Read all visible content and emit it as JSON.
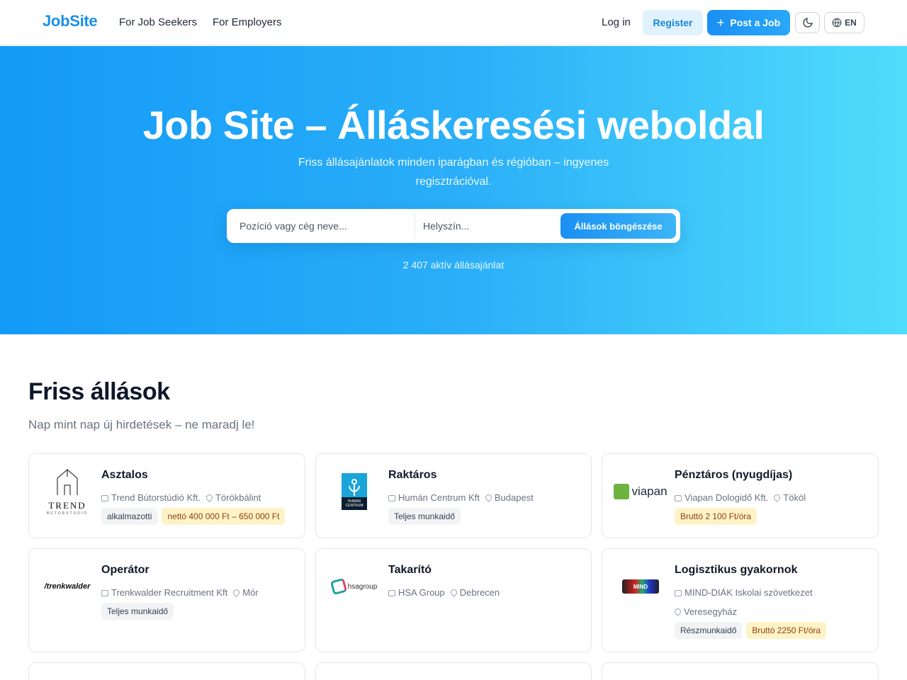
{
  "nav": {
    "logo": "JobSite",
    "links": [
      "For Job Seekers",
      "For Employers"
    ],
    "login": "Log in",
    "register": "Register",
    "post_job": "Post a Job",
    "lang": "EN"
  },
  "hero": {
    "title": "Job Site – Álláskeresési weboldal",
    "subtitle": "Friss állásajánlatok minden iparágban és régióban – ingyenes regisztrációval.",
    "search_position_placeholder": "Pozíció vagy cég neve...",
    "search_location_placeholder": "Helyszín...",
    "browse_button": "Állások böngészése",
    "active_count": "2 407 aktív állásajánlat"
  },
  "section": {
    "title": "Friss állások",
    "subtitle": "Nap mint nap új hirdetések – ne maradj le!"
  },
  "jobs": [
    {
      "title": "Asztalos",
      "company": "Trend Bútorstúdió Kft.",
      "location": "Törökbálint",
      "tags": [
        "alkalmazotti"
      ],
      "salary": "nettó 400 000 Ft – 650 000 Ft",
      "logo": "trend-logo",
      "logo_text": "TREND",
      "logo_sub": "BÚTORSTÚDIÓ"
    },
    {
      "title": "Raktáros",
      "company": "Humán Centrum Kft",
      "location": "Budapest",
      "tags": [
        "Teljes munkaidő"
      ],
      "salary": "",
      "logo": "human-centrum-logo",
      "logo_text": "HUMAN",
      "logo_sub": "CENTRUM"
    },
    {
      "title": "Pénztáros (nyugdíjas)",
      "company": "Viapan Dologidő Kft.",
      "location": "Tököl",
      "tags": [],
      "salary": "Bruttó 2 100 Ft/óra",
      "logo": "viapan-logo",
      "logo_text": "viapan",
      "logo_sub": ""
    },
    {
      "title": "Operátor",
      "company": "Trenkwalder Recruitment Kft",
      "location": "Mór",
      "tags": [
        "Teljes munkaidő"
      ],
      "salary": "",
      "logo": "trenkwalder-logo",
      "logo_text": "/trenkwalder",
      "logo_sub": ""
    },
    {
      "title": "Takarító",
      "company": "HSA Group",
      "location": "Debrecen",
      "tags": [],
      "salary": "",
      "logo": "hsa-group-logo",
      "logo_text": "hsagroup",
      "logo_sub": ""
    },
    {
      "title": "Logisztikus gyakornok",
      "company": "MIND-DIÁK Iskolai szövetkezet",
      "location": "Veresegyház",
      "tags": [
        "Részmunkaidő"
      ],
      "salary": "Bruttó 2250 Ft/óra",
      "logo": "mind-diak-logo",
      "logo_text": "MIND",
      "logo_sub": ""
    }
  ],
  "colors": {
    "brand": "#1a8fe8",
    "hero_start": "#139af7",
    "hero_end": "#50dcfb",
    "salary_tag_bg": "#fef3c7"
  }
}
